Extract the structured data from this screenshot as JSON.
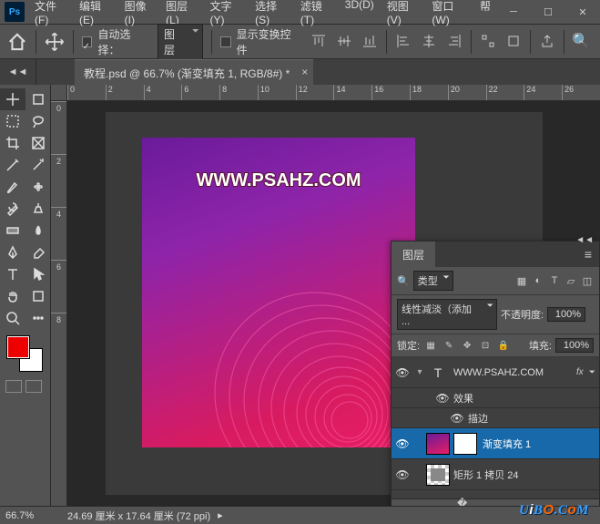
{
  "app": {
    "logo": "Ps"
  },
  "menu": {
    "file": "文件(F)",
    "edit": "编辑(E)",
    "image": "图像(I)",
    "layer": "图层(L)",
    "type": "文字(Y)",
    "select": "选择(S)",
    "filter": "滤镜(T)",
    "threeD": "3D(D)",
    "view": "视图(V)",
    "window": "窗口(W)",
    "help": "帮"
  },
  "options": {
    "auto_select_label": "自动选择：",
    "auto_select_target": "图层",
    "show_transform_label": "显示变换控件"
  },
  "tab": {
    "title": "教程.psd @ 66.7% (渐变填充 1, RGB/8#) *"
  },
  "ruler_h": [
    "0",
    "2",
    "4",
    "6",
    "8",
    "10",
    "12",
    "14",
    "16",
    "18",
    "20",
    "22",
    "24",
    "26"
  ],
  "ruler_v": [
    "0",
    "2",
    "4",
    "6",
    "8"
  ],
  "canvas": {
    "text": "WWW.PSAHZ.COM"
  },
  "panel": {
    "title": "图层",
    "kind_label": "类型",
    "blend_mode": "线性减淡（添加 ...",
    "opacity_label": "不透明度:",
    "opacity_value": "100%",
    "lock_label": "锁定:",
    "fill_label": "填充:",
    "fill_value": "100%",
    "layers": {
      "text_layer": "WWW.PSAHZ.COM",
      "fx_label": "fx",
      "effects": "效果",
      "stroke": "描边",
      "gradient_fill": "渐变填充 1",
      "rect_copy": "矩形 1 拷贝 24"
    }
  },
  "status": {
    "zoom": "66.7%",
    "doc_info": "24.69 厘米 x 17.64 厘米 (72 ppi)"
  },
  "colors": {
    "foreground": "#e00000",
    "background": "#ffffff"
  },
  "watermark": "UiBO.CoM"
}
